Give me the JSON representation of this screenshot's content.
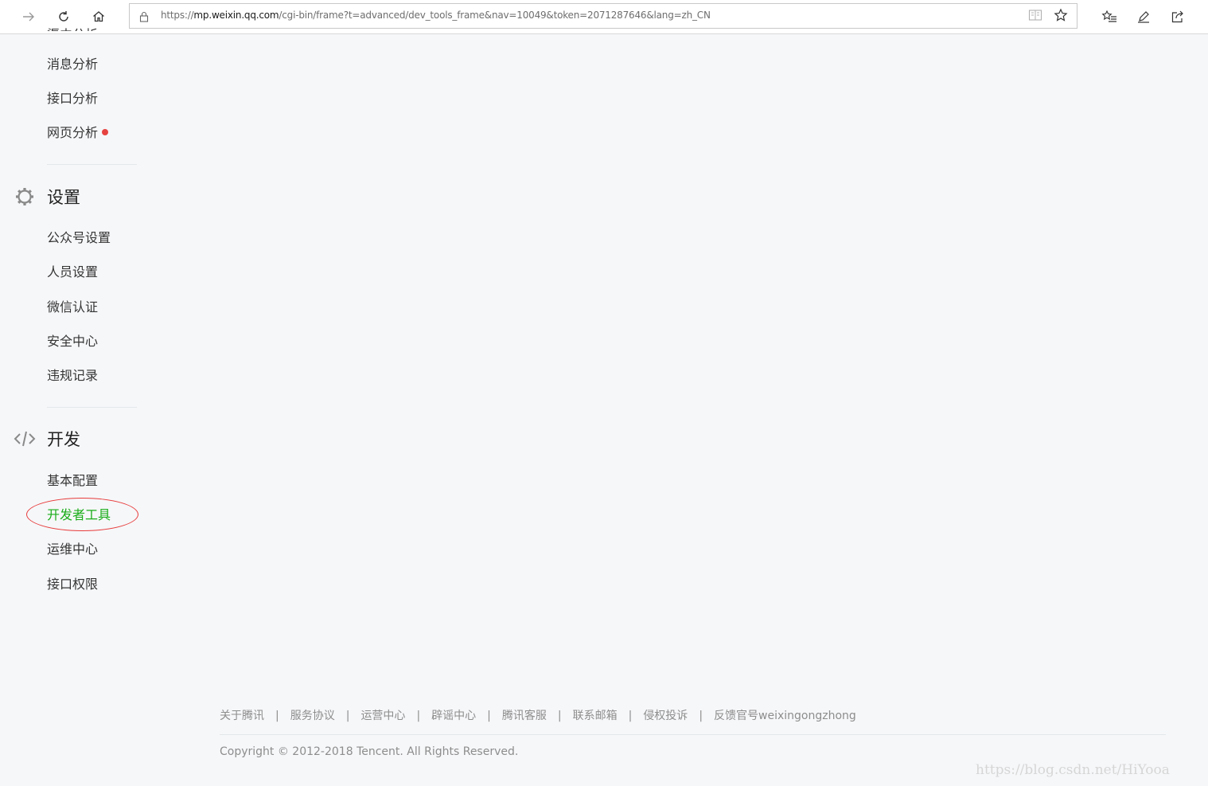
{
  "browser": {
    "url_prefix": "https://",
    "url_host": "mp.weixin.qq.com",
    "url_path": "/cgi-bin/frame?t=advanced/dev_tools_frame&nav=10049&token=2071287646&lang=zh_CN",
    "icons": {
      "forward": "forward-arrow-icon",
      "refresh": "refresh-icon",
      "home": "home-icon",
      "lock": "lock-icon",
      "reading_view": "reading-view-icon",
      "favorite": "star-icon",
      "favorites_hub": "favorites-list-icon",
      "notes": "pen-icon",
      "share": "share-icon"
    }
  },
  "sidebar": {
    "clipped_item": "渠中分析",
    "analysis_items": [
      {
        "label": "消息分析"
      },
      {
        "label": "接口分析"
      },
      {
        "label": "网页分析",
        "badge": "red-dot"
      }
    ],
    "settings": {
      "title": "设置",
      "icon": "gear-icon",
      "items": [
        {
          "label": "公众号设置"
        },
        {
          "label": "人员设置"
        },
        {
          "label": "微信认证"
        },
        {
          "label": "安全中心"
        },
        {
          "label": "违规记录"
        }
      ]
    },
    "develop": {
      "title": "开发",
      "icon": "code-icon",
      "items": [
        {
          "label": "基本配置"
        },
        {
          "label": "开发者工具",
          "active": true
        },
        {
          "label": "运维中心"
        },
        {
          "label": "接口权限"
        }
      ]
    }
  },
  "footer": {
    "links": [
      "关于腾讯",
      "服务协议",
      "运营中心",
      "辟谣中心",
      "腾讯客服",
      "联系邮箱",
      "侵权投诉",
      "反馈官号weixingongzhong"
    ],
    "separator": "|",
    "copyright": "Copyright © 2012-2018 Tencent. All Rights Reserved."
  },
  "watermark": "https://blog.csdn.net/HiYooa",
  "colors": {
    "accent_green": "#1aad19",
    "badge_red": "#e64340",
    "annotation_red": "#e83b3b",
    "background": "#f6f7f9"
  }
}
